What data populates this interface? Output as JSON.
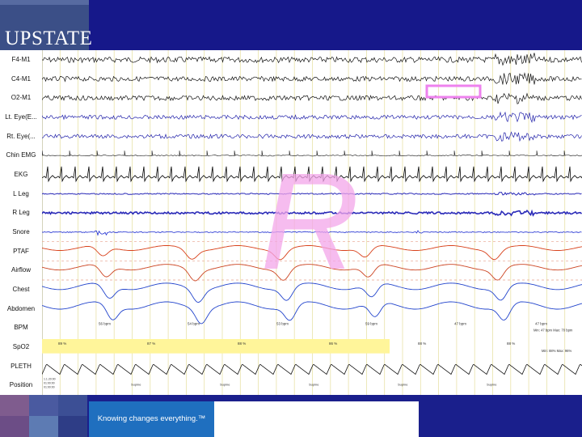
{
  "brand": {
    "logo_text": "UPSTATE",
    "tagline": "Knowing changes everything.™"
  },
  "channels": [
    "F4-M1",
    "C4-M1",
    "O2-M1",
    "Lt. Eye(E...",
    "Rt. Eye(...",
    "Chin EMG",
    "EKG",
    "L Leg",
    "R Leg",
    "Snore",
    "PTAF",
    "Airflow",
    "Chest",
    "Abdomen",
    "BPM",
    "SpO2",
    "PLETH",
    "Position"
  ],
  "overlay": {
    "letter": "R",
    "color": "#f3a6ea",
    "marker_color": "#ee82ee"
  },
  "bpm_readings": [
    "56 bpm",
    "54 bpm",
    "53 bpm",
    "59 bpm",
    "47 bpm",
    "47 bpm"
  ],
  "bpm_summary": "Min: 47 bpm  Max: 70 bpm",
  "spo2_readings": [
    "89 %",
    "87 %",
    "88 %",
    "86 %",
    "88 %",
    "88 %"
  ],
  "spo2_summary": "Min: 88%  Max: 96%",
  "position_readings": [
    "Supine",
    "Supine",
    "Supine",
    "Supine",
    "Supine"
  ],
  "position_header": [
    "1.1.20:00",
    "01:00:00",
    "01:00:00"
  ],
  "colors": {
    "eeg": "#111111",
    "eye": "#2222aa",
    "emg": "#333333",
    "leg": "#2a2ab8",
    "snore": "#1a2ad0",
    "ptaf": "#d8401a",
    "airflow": "#cc4422",
    "chest": "#2244cc",
    "abdomen": "#2244cc",
    "grid": "#e8e2a8",
    "spo2_band": "#fff59a"
  }
}
